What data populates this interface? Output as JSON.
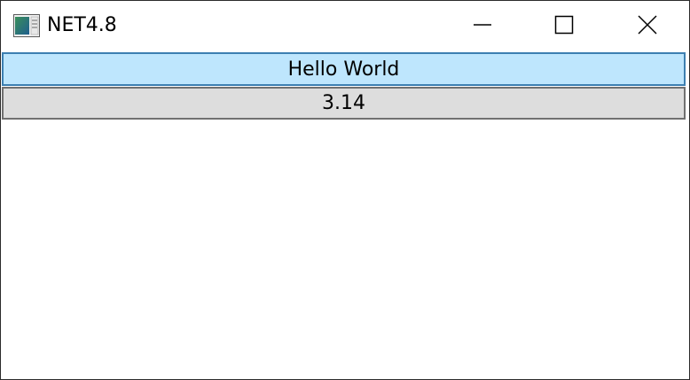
{
  "window": {
    "title": "NET4.8",
    "app_icon": "app-window-icon",
    "controls": {
      "minimize_icon": "minimize-icon",
      "maximize_icon": "maximize-icon",
      "close_icon": "close-icon"
    }
  },
  "content": {
    "buttons": [
      {
        "label": "Hello World",
        "state": "hover",
        "background": "#bee6fd",
        "border": "#3c7fb1"
      },
      {
        "label": "3.14",
        "state": "normal",
        "background": "#dddddd",
        "border": "#707070"
      }
    ]
  }
}
